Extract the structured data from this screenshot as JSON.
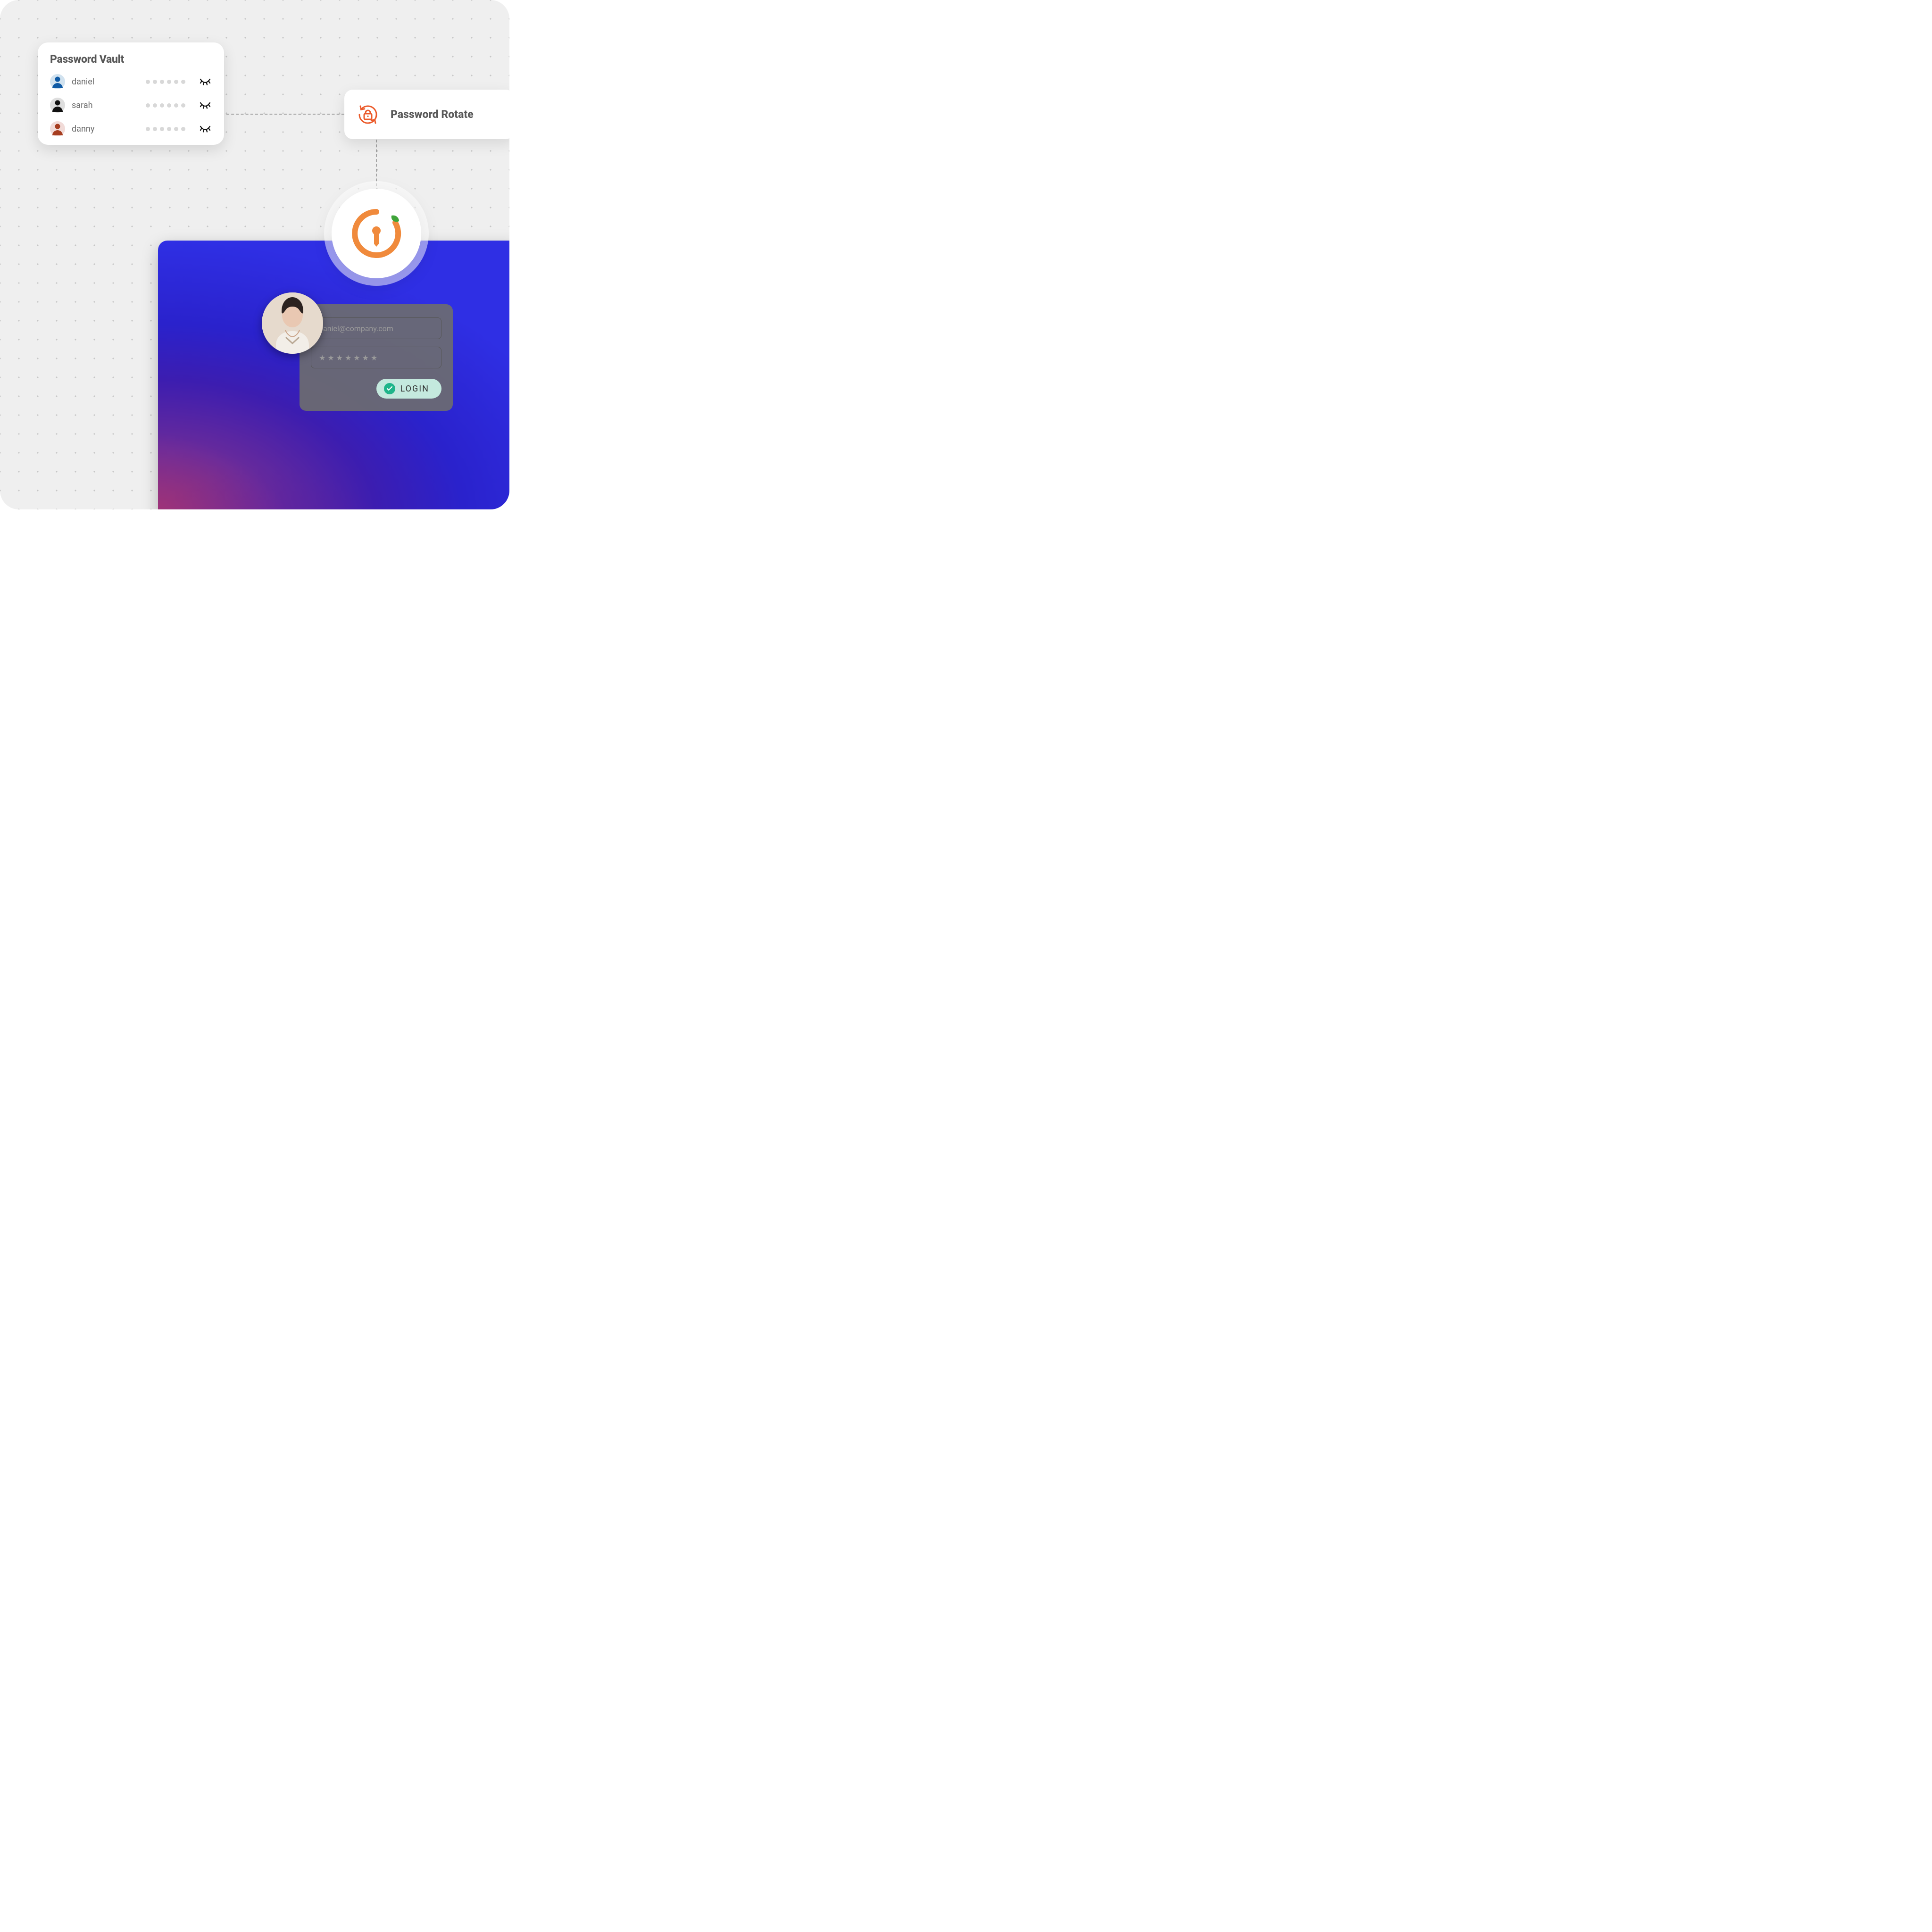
{
  "vault": {
    "title": "Password Vault",
    "rows": [
      {
        "name": "daniel",
        "avatar_colors": [
          "#9ccaf0",
          "#0f5aa5"
        ]
      },
      {
        "name": "sarah",
        "avatar_colors": [
          "#bfbfbf",
          "#111111"
        ]
      },
      {
        "name": "danny",
        "avatar_colors": [
          "#f6b7b0",
          "#a63d1f"
        ]
      }
    ],
    "masked_dots": 6
  },
  "rotate": {
    "title": "Password Rotate",
    "icon_color": "#eb5a2a"
  },
  "badge": {
    "ring_color": "#f08a3c",
    "leaf_color": "#3fa43a"
  },
  "login": {
    "email": "daniel@company.com",
    "password_mask": "★ ★ ★ ★ ★ ★ ★",
    "button_label": "LOGIN",
    "button_bg": "#c4e9de",
    "check_bg": "#1fb58a"
  }
}
